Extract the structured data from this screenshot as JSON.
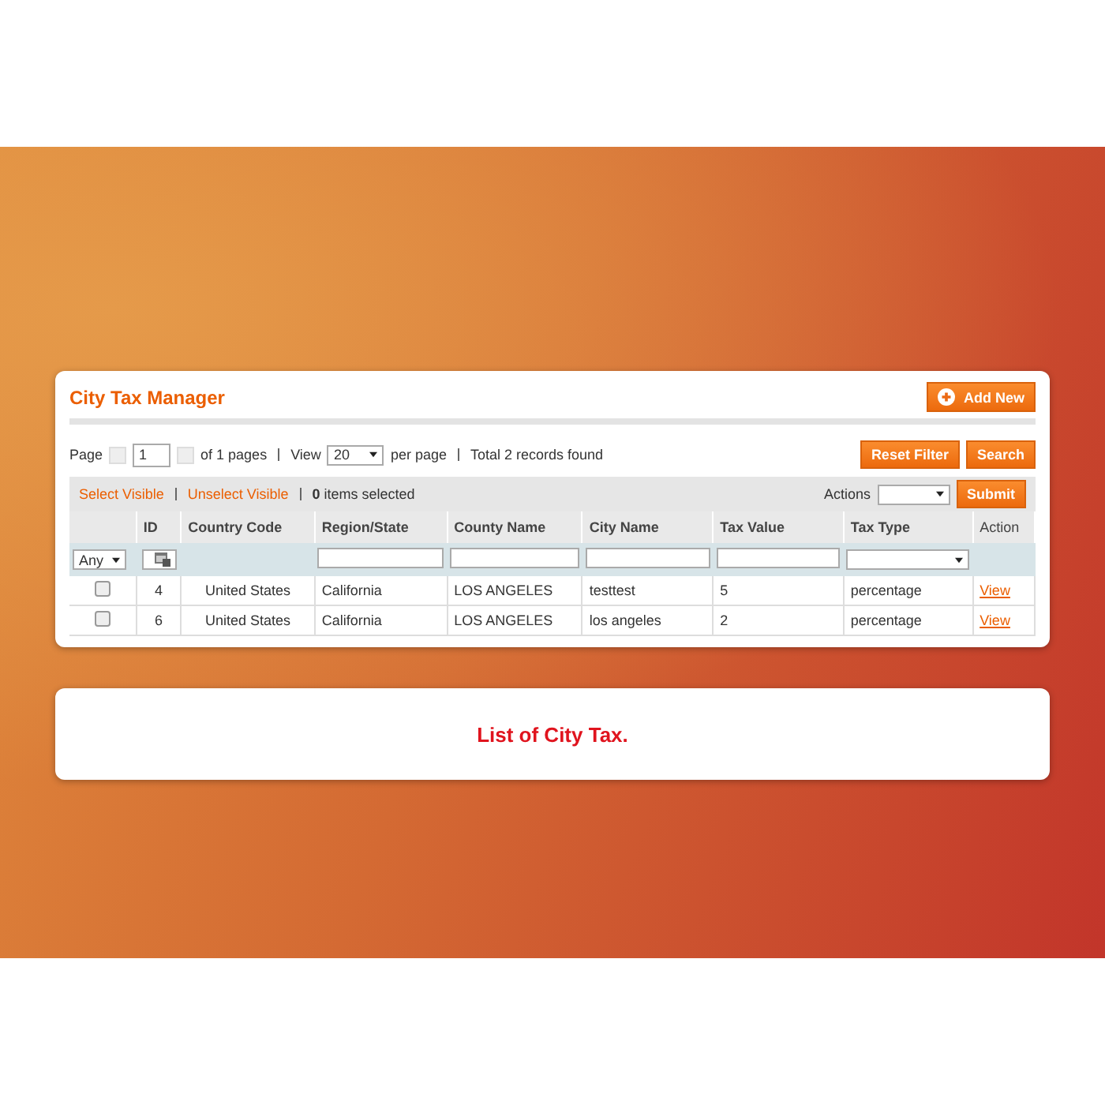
{
  "grid": {
    "title": "City Tax Manager",
    "add_button": "Add New",
    "pager": {
      "page_label": "Page",
      "page_value": "1",
      "of_pages": "of 1 pages",
      "view_label": "View",
      "view_value": "20",
      "per_page": "per page",
      "total": "Total 2 records found"
    },
    "buttons": [
      "Reset Filter",
      "Search"
    ],
    "massaction": {
      "select_visible": "Select Visible",
      "unselect_visible": "Unselect Visible",
      "selected": "**0** items selected",
      "actions_label": "Actions",
      "submit": "Submit"
    },
    "columns": [
      "ID",
      "Country Code",
      "Region/State",
      "County Name",
      "City Name",
      "Tax Value",
      "Tax Type",
      "Action"
    ],
    "filters": [
      {
        "kind": "select",
        "value": "Any"
      },
      {
        "kind": "range"
      },
      {
        "kind": "none"
      },
      {
        "kind": "text"
      },
      {
        "kind": "text"
      },
      {
        "kind": "text"
      },
      {
        "kind": "text"
      },
      {
        "kind": "select"
      },
      {
        "kind": "none"
      }
    ],
    "rows": [
      {
        "checked": false,
        "cells": [
          "4",
          "United States",
          "California",
          "LOS ANGELES",
          "testtest",
          "5",
          "percentage"
        ],
        "action": "View"
      },
      {
        "checked": false,
        "cells": [
          "6",
          "United States",
          "California",
          "LOS ANGELES",
          "los angeles",
          "2",
          "percentage"
        ],
        "action": "View"
      }
    ]
  },
  "caption": "List of City Tax."
}
